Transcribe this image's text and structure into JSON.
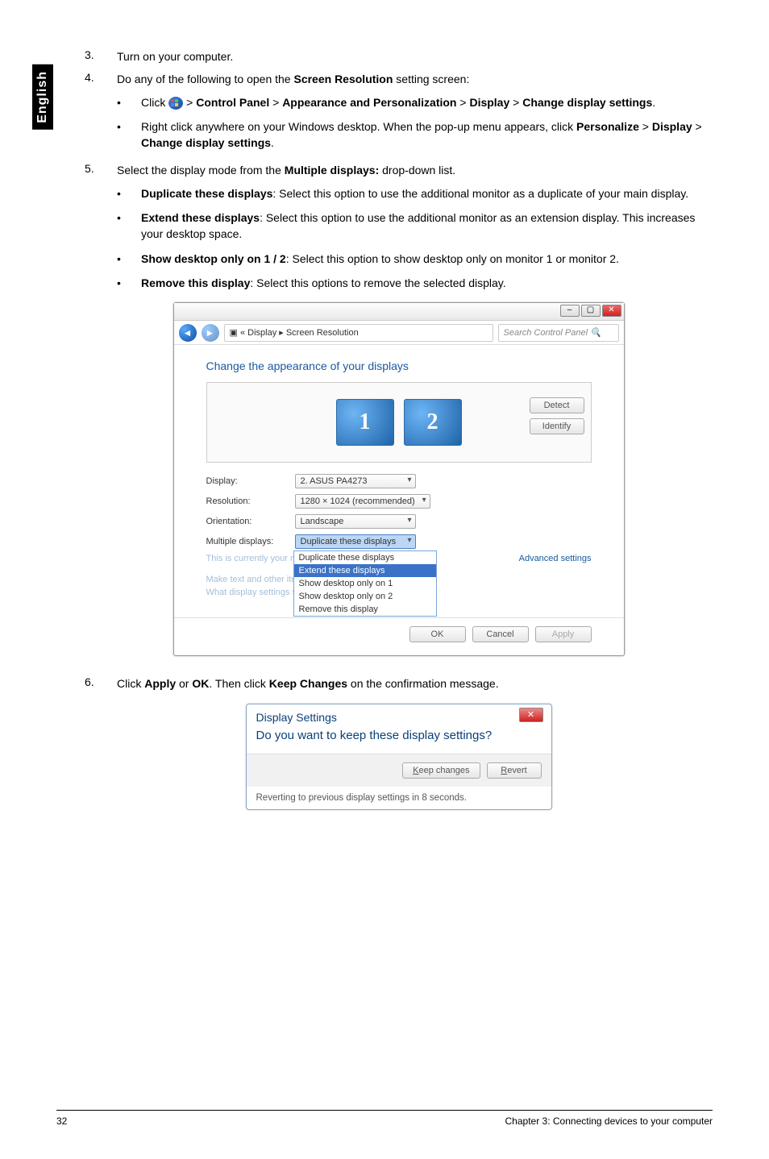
{
  "sideTab": "English",
  "step3": {
    "num": "3.",
    "text": "Turn on your computer."
  },
  "step4": {
    "num": "4.",
    "text_a": "Do any of the following to open the ",
    "text_b": "Screen Resolution",
    "text_c": " setting screen:"
  },
  "step4bullets": {
    "a": {
      "pre": "Click ",
      "p1": " > ",
      "b1": "Control Panel",
      "p2": " > ",
      "b2": "Appearance and Personalization",
      "p3": " > ",
      "b3": "Display",
      "p4": " > ",
      "b4": "Change display settings",
      "post": "."
    },
    "b": {
      "t1": "Right click anywhere on your Windows desktop. When the pop-up menu appears, click ",
      "b1": "Personalize",
      "p1": " > ",
      "b2": "Display",
      "p2": " > ",
      "b3": "Change display settings",
      "post": "."
    }
  },
  "step5": {
    "num": "5.",
    "t1": "Select the display mode from the ",
    "b1": "Multiple displays:",
    "t2": " drop-down list."
  },
  "step5bullets": {
    "dup": {
      "b": "Duplicate these displays",
      "t": ": Select this option to use the additional monitor as a duplicate of your main display."
    },
    "ext": {
      "b": "Extend these displays",
      "t": ": Select this option to use the additional monitor as an extension display. This increases your desktop space."
    },
    "show": {
      "b": "Show desktop only on 1 / 2",
      "t": ": Select this option to show desktop only on monitor 1 or monitor 2."
    },
    "rem": {
      "b": "Remove this display",
      "t": ": Select this options to remove the selected display."
    }
  },
  "srWindow": {
    "breadcrumb": "▣ « Display ▸ Screen Resolution",
    "searchPlaceholder": "Search Control Panel",
    "heading": "Change the appearance of your displays",
    "monitor1": "1",
    "monitor2": "2",
    "detect": "Detect",
    "identify": "Identify",
    "labels": {
      "display": "Display:",
      "resolution": "Resolution:",
      "orientation": "Orientation:",
      "multiple": "Multiple displays:"
    },
    "values": {
      "display": "2. ASUS PA4273",
      "resolution": "1280 × 1024 (recommended)",
      "orientation": "Landscape",
      "multiple": "Duplicate these displays"
    },
    "menu": {
      "opt1": "Duplicate these displays",
      "opt2": "Extend these displays",
      "opt3": "Show desktop only on 1",
      "opt4": "Show desktop only on 2",
      "opt5": "Remove this display"
    },
    "note1": "This is currently your main display.",
    "note2": "Make text and other items larger or smaller",
    "note3": "What display settings should I choose?",
    "advanced": "Advanced settings",
    "ok": "OK",
    "cancel": "Cancel",
    "apply": "Apply"
  },
  "step6": {
    "num": "6.",
    "t1": "Click ",
    "b1": "Apply",
    "t2": " or ",
    "b2": "OK",
    "t3": ". Then click ",
    "b3": "Keep Changes",
    "t4": " on the confirmation message."
  },
  "confDialog": {
    "title": "Display Settings",
    "question": "Do you want to keep these display settings?",
    "keep": "Keep changes",
    "revert": "Revert",
    "footer": "Reverting to previous display settings in 8 seconds."
  },
  "footer": {
    "page": "32",
    "chapter": "Chapter 3: Connecting devices to your computer"
  }
}
